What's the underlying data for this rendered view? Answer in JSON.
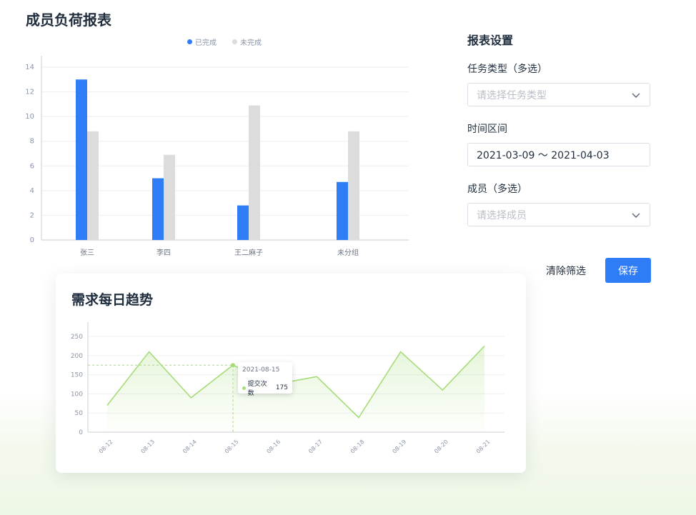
{
  "page": {
    "title": "成员负荷报表"
  },
  "colors": {
    "completed": "#2e7cf6",
    "incomplete": "#dcdcdc",
    "trend": "#a6dc79",
    "primary": "#2e7cf6"
  },
  "settings": {
    "title": "报表设置",
    "task_type": {
      "label": "任务类型（多选）",
      "placeholder": "请选择任务类型"
    },
    "time_range": {
      "label": "时间区间",
      "value": "2021-03-09 ～ 2021-04-03"
    },
    "members": {
      "label": "成员（多选）",
      "placeholder": "请选择成员"
    },
    "clear_label": "清除筛选",
    "save_label": "保存"
  },
  "trend_card": {
    "title": "需求每日趋势",
    "tooltip": {
      "date": "2021-08-15",
      "series": "提交次数",
      "value": "175"
    }
  },
  "chart_data": [
    {
      "type": "bar",
      "categories": [
        "张三",
        "李四",
        "王二麻子",
        "未分组"
      ],
      "series": [
        {
          "name": "已完成",
          "values": [
            13,
            5,
            2.8,
            4.7
          ]
        },
        {
          "name": "未完成",
          "values": [
            8.8,
            6.9,
            10.9,
            8.8
          ]
        }
      ],
      "ylim": [
        0,
        14
      ],
      "yticks": [
        0,
        2,
        4,
        6,
        8,
        10,
        12,
        14
      ],
      "legend": "top-center",
      "grid": true
    },
    {
      "type": "area",
      "x": [
        "08-12",
        "08-13",
        "08-14",
        "08-15",
        "08-16",
        "08-17",
        "08-18",
        "08-19",
        "08-20",
        "08-21"
      ],
      "series": [
        {
          "name": "提交次数",
          "values": [
            70,
            210,
            90,
            175,
            125,
            145,
            38,
            210,
            110,
            225
          ]
        }
      ],
      "ylim": [
        0,
        250
      ],
      "yticks": [
        0,
        50,
        100,
        150,
        200,
        250
      ],
      "grid": true
    }
  ]
}
